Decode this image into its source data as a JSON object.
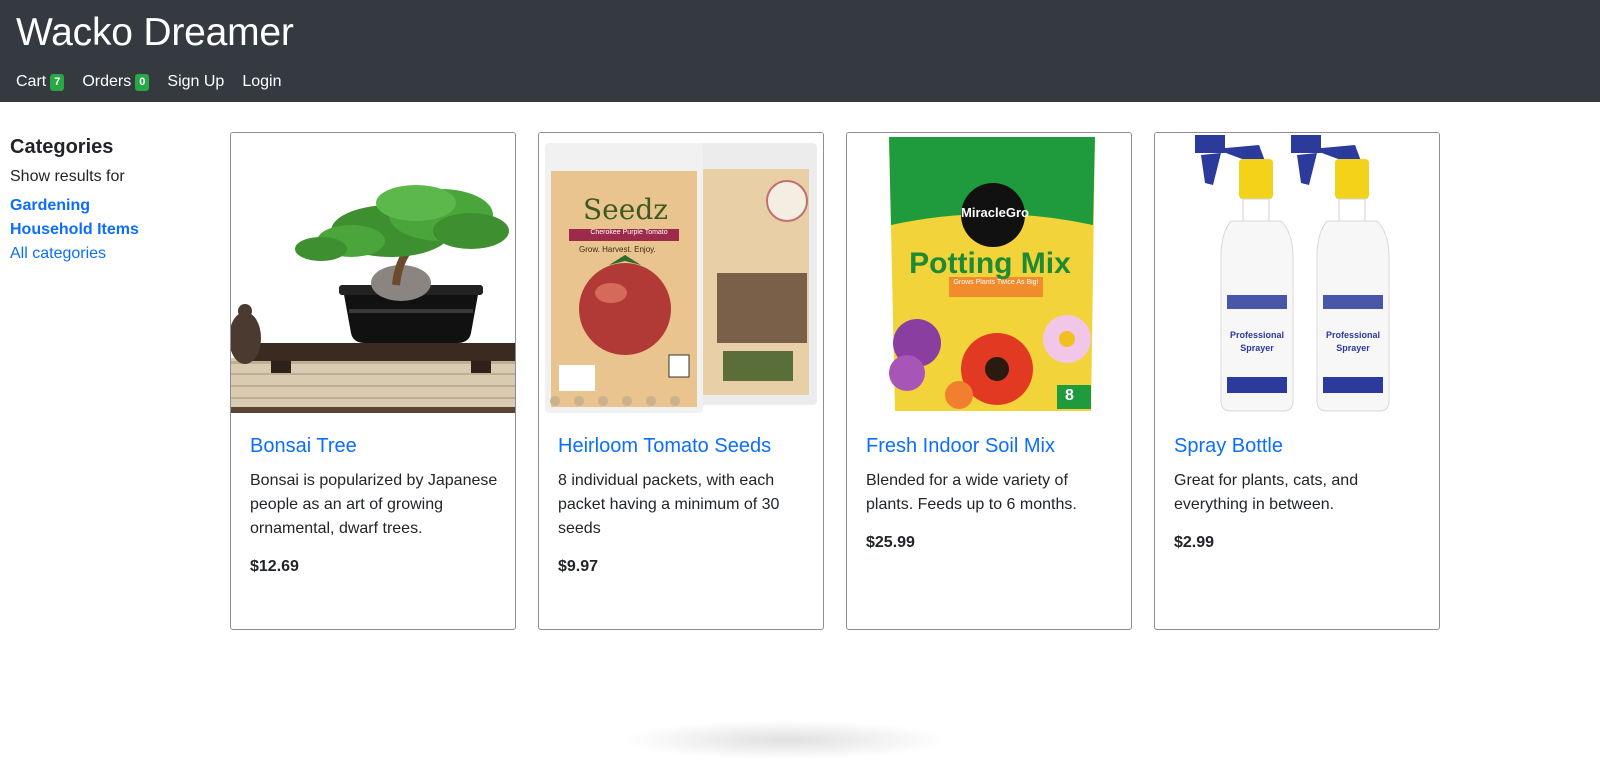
{
  "header": {
    "brand": "Wacko Dreamer",
    "nav": [
      {
        "label": "Cart",
        "badge": "7"
      },
      {
        "label": "Orders",
        "badge": "0"
      },
      {
        "label": "Sign Up"
      },
      {
        "label": "Login"
      }
    ]
  },
  "sidebar": {
    "title": "Categories",
    "subtitle": "Show results for",
    "links": [
      "Gardening",
      "Household Items",
      "All categories"
    ]
  },
  "products": [
    {
      "name": "Bonsai Tree",
      "description": "Bonsai is popularized by Japanese people as an art of growing ornamental, dwarf trees.",
      "price": "$12.69",
      "image": "bonsai-tree-image"
    },
    {
      "name": "Heirloom Tomato Seeds",
      "description": "8 individual packets, with each packet having a minimum of 30 seeds",
      "price": "$9.97",
      "image": "seed-packets-image",
      "image_text": {
        "brand": "Seedz",
        "variety": "Cherokee Purple Tomato",
        "tagline": "Grow. Harvest. Enjoy."
      }
    },
    {
      "name": "Fresh Indoor Soil Mix",
      "description": "Blended for a wide variety of plants. Feeds up to 6 months.",
      "price": "$25.99",
      "image": "potting-mix-bag-image",
      "image_text": {
        "brand": "MiracleGro",
        "product": "Potting Mix",
        "badge": "Grows Plants Twice As Big!",
        "size": "8"
      }
    },
    {
      "name": "Spray Bottle",
      "description": "Great for plants, cats, and everything in between.",
      "price": "$2.99",
      "image": "spray-bottles-image",
      "image_text": {
        "label": "Professional Sprayer"
      }
    }
  ],
  "colors": {
    "navbar": "#343a40",
    "link": "#0d6efd",
    "badge": "#28a745"
  }
}
